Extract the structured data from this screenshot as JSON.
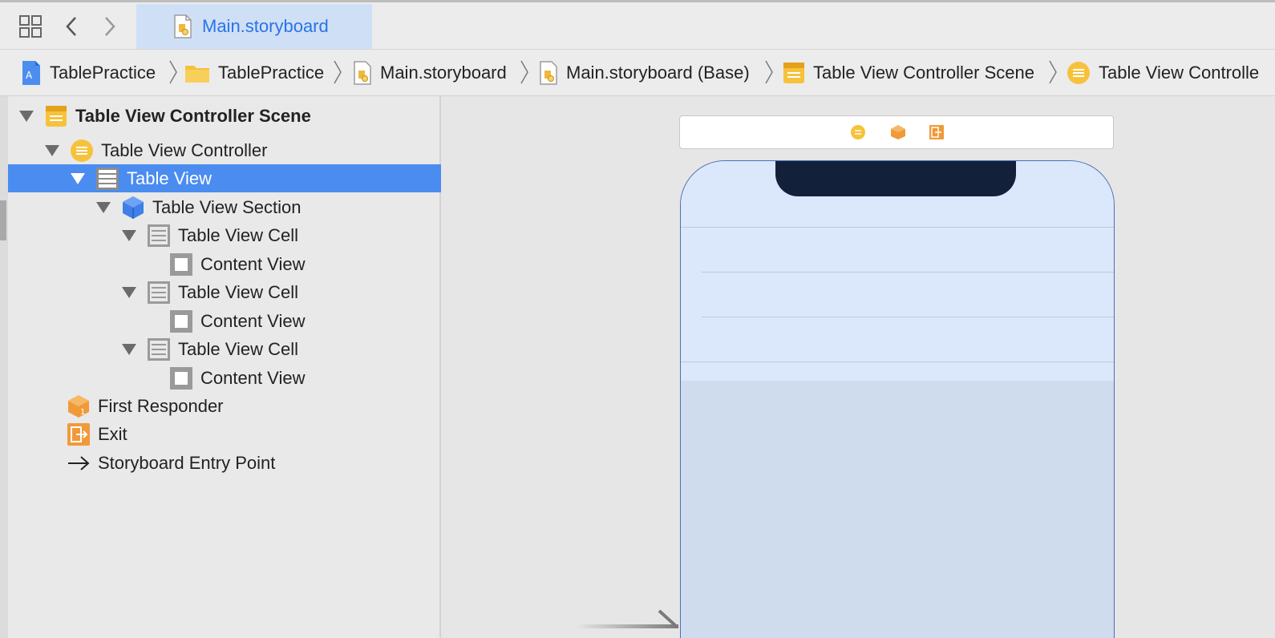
{
  "window": {
    "tab": {
      "label": "Main.storyboard",
      "icon": "storyboard-file-icon"
    },
    "toolbar_icons": [
      "grid-icon",
      "back-chevron-icon",
      "forward-chevron-icon"
    ]
  },
  "breadcrumb": [
    {
      "label": "TablePractice",
      "icon": "xcode-project-icon"
    },
    {
      "label": "TablePractice",
      "icon": "folder-icon"
    },
    {
      "label": "Main.storyboard",
      "icon": "storyboard-file-icon"
    },
    {
      "label": "Main.storyboard (Base)",
      "icon": "storyboard-file-icon"
    },
    {
      "label": "Table View Controller Scene",
      "icon": "scene-icon"
    },
    {
      "label": "Table View Controlle",
      "icon": "view-controller-icon"
    }
  ],
  "outline": {
    "items": [
      {
        "label": "Table View Controller Scene",
        "icon": "scene-icon",
        "expanded": true
      },
      {
        "label": "Table View Controller",
        "icon": "view-controller-icon",
        "expanded": true
      },
      {
        "label": "Table View",
        "icon": "table-view-icon",
        "expanded": true,
        "selected": true
      },
      {
        "label": "Table View Section",
        "icon": "cube-icon",
        "expanded": true
      },
      {
        "label": "Table View Cell",
        "icon": "table-cell-icon",
        "expanded": true
      },
      {
        "label": "Content View",
        "icon": "content-view-icon"
      },
      {
        "label": "Table View Cell",
        "icon": "table-cell-icon",
        "expanded": true
      },
      {
        "label": "Content View",
        "icon": "content-view-icon"
      },
      {
        "label": "Table View Cell",
        "icon": "table-cell-icon",
        "expanded": true
      },
      {
        "label": "Content View",
        "icon": "content-view-icon"
      },
      {
        "label": "First Responder",
        "icon": "first-responder-icon"
      },
      {
        "label": "Exit",
        "icon": "exit-icon"
      },
      {
        "label": "Storyboard Entry Point",
        "icon": "arrow-right-icon"
      }
    ]
  },
  "canvas": {
    "scene_dock_icons": [
      "view-controller-icon",
      "first-responder-icon",
      "exit-icon"
    ]
  },
  "colors": {
    "selection": "#4a8cf0",
    "tab_bg": "#cfe0f6",
    "accent_text": "#2a73e6",
    "phone_fill": "#dbe7fb"
  }
}
